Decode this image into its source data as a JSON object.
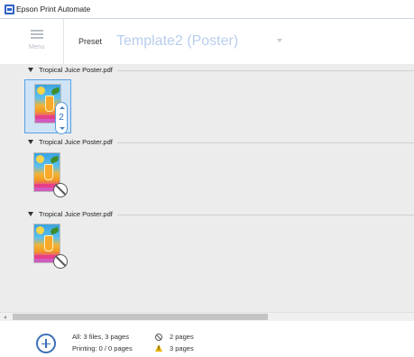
{
  "window": {
    "title": "Epson Print Automate"
  },
  "header": {
    "menu_label": "Menu",
    "preset_label": "Preset",
    "preset_value": "Template2 (Poster)"
  },
  "files": [
    {
      "name": "Tropical Juice Poster.pdf",
      "state": "selected",
      "copies": "2"
    },
    {
      "name": "Tropical Juice Poster.pdf",
      "state": "not-printing"
    },
    {
      "name": "Tropical Juice Poster.pdf",
      "state": "not-printing"
    }
  ],
  "footer": {
    "summary_all": "All: 3 files, 3 pages",
    "summary_printing": "Printing: 0 / 0 pages",
    "no_print_count": "2 pages",
    "warning_count": "3 pages"
  },
  "icons": {
    "app": "epson-app-icon",
    "menu": "hamburger-icon",
    "dropdown": "chevron-down-icon",
    "expand": "triangle-down-icon",
    "no_print": "prohibited-icon",
    "warning": "warning-icon",
    "add": "add-circle-icon"
  },
  "colors": {
    "accent": "#3c6fb8",
    "selection_bg": "#cfe3f7",
    "preset_text": "#b9cdee",
    "content_bg": "#ececec",
    "warning": "#e8b400"
  }
}
